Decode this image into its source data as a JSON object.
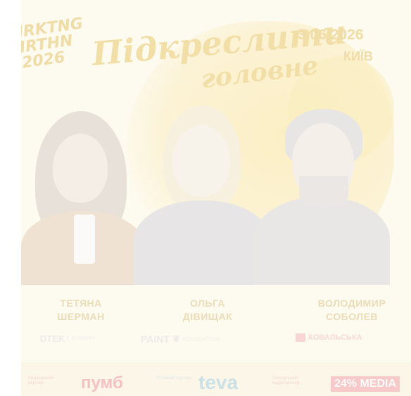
{
  "event": {
    "logo_lines": [
      "MRKTNG",
      "MRTHN",
      "2026"
    ],
    "headline_line1": "Підкреслити",
    "headline_line2": "головне",
    "date": "3.06.2026",
    "city": "КИЇВ"
  },
  "speakers": [
    {
      "first_name": "ТЕТЯНА",
      "last_name": "ШЕРМАН",
      "company": "DTEK",
      "company_sub": "ACADEMY"
    },
    {
      "first_name": "ОЛЬГА",
      "last_name": "ДІВИЩАК",
      "company": "PAINT",
      "company_sub": "FOUNDATION"
    },
    {
      "first_name": "ВОЛОДИМИР",
      "last_name": "СОБОЛЕВ",
      "company": "КОВАЛЬСЬКА",
      "company_sub": ""
    }
  ],
  "sponsors": [
    {
      "caption": "Генеральний партнер",
      "name": "пумб"
    },
    {
      "caption": "Головний партнер",
      "name": "teva"
    },
    {
      "caption": "Генеральний медіапартнер",
      "name": "24% MEDIA"
    }
  ],
  "colors": {
    "background": "#fdfaef",
    "headline": "#f2dfa7",
    "name_text": "#ecdcb7"
  }
}
